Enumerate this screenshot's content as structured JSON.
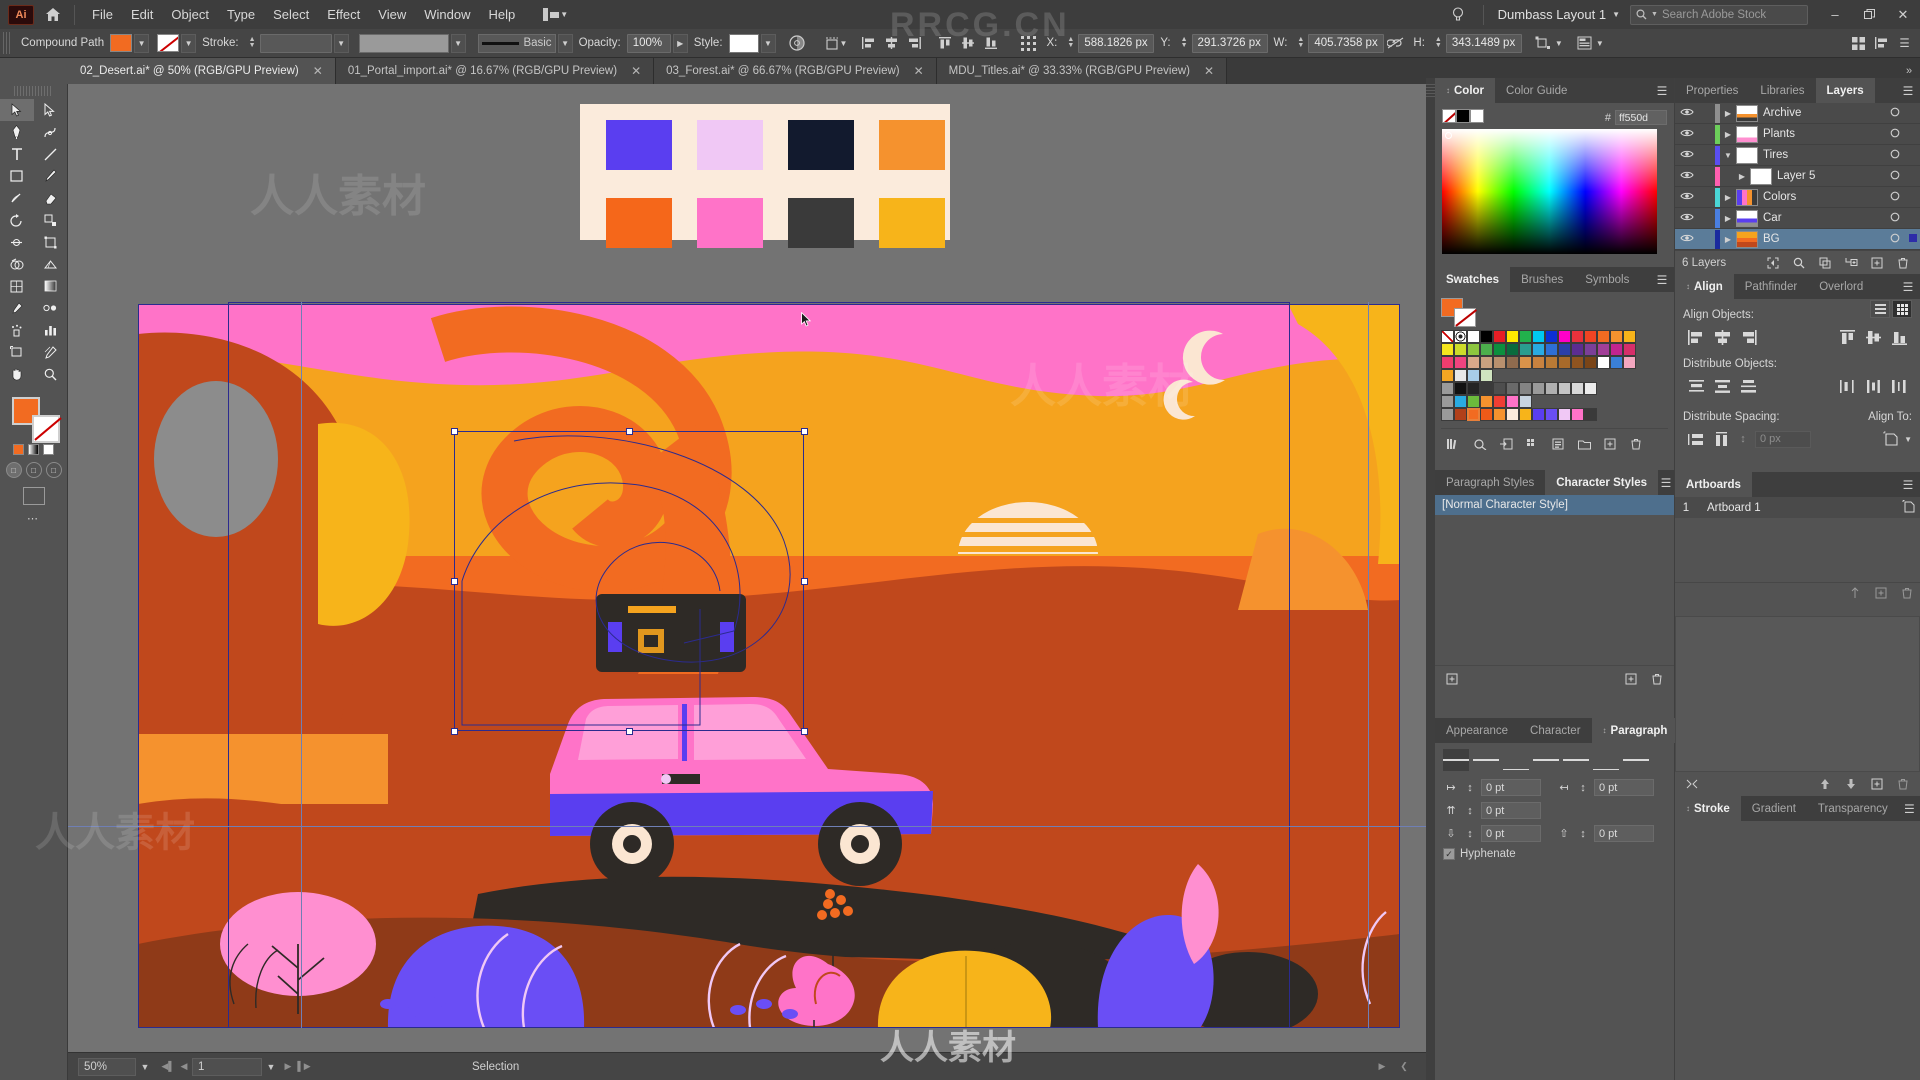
{
  "app": {
    "logo": "Ai",
    "home_icon": "home-icon"
  },
  "menubar": {
    "items": [
      "File",
      "Edit",
      "Object",
      "Type",
      "Select",
      "Effect",
      "View",
      "Window",
      "Help"
    ],
    "layout_name": "Dumbass Layout 1",
    "search_placeholder": "Search Adobe Stock",
    "bulb_icon": "lightbulb-icon",
    "minimize": "–",
    "restore": "❐",
    "close": "✕"
  },
  "controlbar": {
    "object_label": "Compound Path",
    "fill_color": "#f26b21",
    "stroke_label": "Stroke:",
    "stroke_weight": "",
    "brush_label": "Basic",
    "opacity_label": "Opacity:",
    "opacity_value": "100%",
    "style_label": "Style:",
    "x_label": "X:",
    "x_value": "588.1826 px",
    "y_label": "Y:",
    "y_value": "291.3726 px",
    "w_label": "W:",
    "w_value": "405.7358 px",
    "h_label": "H:",
    "h_value": "343.1489 px",
    "link_icon": "unlink-icon",
    "transform_icon": "transform-icon",
    "document_setup_icon": "document-setup-icon",
    "preferences_icon": "preferences-icon",
    "arrange_icon": "arrange-icon",
    "align_icon": "align-icon",
    "more_icon": "more-options-icon"
  },
  "tabs": [
    {
      "label": "02_Desert.ai* @ 50% (RGB/GPU Preview)",
      "active": true
    },
    {
      "label": "01_Portal_import.ai* @ 16.67% (RGB/GPU Preview)",
      "active": false
    },
    {
      "label": "03_Forest.ai* @ 66.67% (RGB/GPU Preview)",
      "active": false
    },
    {
      "label": "MDU_Titles.ai* @ 33.33% (RGB/GPU Preview)",
      "active": false
    }
  ],
  "toolbar": {
    "tools": [
      "selection-tool",
      "direct-selection-tool",
      "pen-tool",
      "curvature-tool",
      "type-tool",
      "line-segment-tool",
      "rectangle-tool",
      "paintbrush-tool",
      "shaper-tool",
      "eraser-tool",
      "rotate-tool",
      "scale-tool",
      "width-tool",
      "free-transform-tool",
      "shape-builder-tool",
      "perspective-grid-tool",
      "mesh-tool",
      "gradient-tool",
      "eyedropper-tool",
      "blend-tool",
      "symbol-sprayer-tool",
      "column-graph-tool",
      "artboard-tool",
      "slice-tool",
      "hand-tool",
      "zoom-tool"
    ],
    "fill_color": "#f26b21",
    "stroke_color": "#ffffff",
    "more_tools": "⋯"
  },
  "canvas": {
    "swatch_card": {
      "row1": [
        "#5a3ef0",
        "#f0c8f5",
        "#121a2e",
        "#f5922e"
      ],
      "row2": [
        "#f5671a",
        "#ff73c8",
        "#3a3a3a",
        "#f7b41a"
      ]
    },
    "artwork_name": "desert-sunset-illustration",
    "zoom": "50%"
  },
  "statusbar": {
    "zoom": "50%",
    "page": "1",
    "tool": "Selection",
    "first_icon": "first-page-icon",
    "prev_icon": "prev-page-icon",
    "next_icon": "next-page-icon",
    "last_icon": "last-page-icon"
  },
  "color_panel": {
    "tabs": [
      "Color",
      "Color Guide"
    ],
    "active": "Color",
    "hex_prefix": "#",
    "hex_value": "ff550d"
  },
  "swatches_panel": {
    "tabs": [
      "Swatches",
      "Brushes",
      "Symbols"
    ],
    "active": "Swatches",
    "current_fill": "#f26b21",
    "rows": [
      [
        "none",
        "registration",
        "#ffffff",
        "#000000",
        "#e61e25",
        "#ffe800",
        "#22b14c",
        "#00c8f0",
        "#0b2fd6",
        "#ff00c8",
        "#e8323c",
        "#f04423",
        "#f26b21",
        "#f5922e",
        "#f7b41a"
      ],
      [
        "#f5e61e",
        "#cddb2a",
        "#8dc63f",
        "#4cae4c",
        "#0c8f3e",
        "#0a6b3d",
        "#2a9d8f",
        "#29abe2",
        "#2e6fd6",
        "#2b3fa8",
        "#5c2d91",
        "#7b3f98",
        "#a23f98",
        "#c2248f",
        "#d62e6a"
      ],
      [
        "#ee3d6e",
        "#f0447f",
        "#d9a88a",
        "#c9a07f",
        "#b8906e",
        "#8f6b4e",
        "#d9934a",
        "#c8823f",
        "#b97a35",
        "#a86a2a",
        "#8f5420",
        "#7a4518",
        "#ffffff",
        "#3a7fd6",
        "#f4a7c0"
      ],
      [
        "#f5a623",
        "#e8e8e8",
        "#a8cde8",
        "#d0e4c0"
      ],
      [
        "folder",
        "#121212",
        "#242424",
        "#3a3a3a",
        "#4e4e4e",
        "#6a6a6a",
        "#848484",
        "#9a9a9a",
        "#b0b0b0",
        "#c4c4c4",
        "#d8d8d8",
        "#ececec"
      ],
      [
        "folder",
        "#29abe2",
        "#6cbb3c",
        "#f5922e",
        "#ef3e33",
        "#ff73c8",
        "#c8d4e0"
      ],
      [
        "folder",
        "#b1401a",
        "#f26b21",
        "#ef5a18",
        "#f5922e",
        "#fbebdc",
        "#f7b41a",
        "#5a3ef0",
        "#6a4ef5",
        "#f0c8f5",
        "#ff73c8",
        "#3a3a3a"
      ]
    ],
    "footer_icons": [
      "libraries-icon",
      "color-group-icon",
      "import-icon",
      "show-swatches-icon",
      "swatch-options-icon",
      "new-group-icon",
      "new-swatch-icon",
      "delete-swatch-icon"
    ]
  },
  "character_styles_panel": {
    "tabs": [
      "Paragraph Styles",
      "Character Styles"
    ],
    "active": "Character Styles",
    "items": [
      "[Normal Character Style]"
    ],
    "footer_icons": [
      "new-style-icon",
      "delete-style-icon"
    ]
  },
  "paragraph_panel": {
    "tabs": [
      "Appearance",
      "Character",
      "Paragraph"
    ],
    "active": "Paragraph",
    "align_buttons": [
      "align-left",
      "align-center",
      "align-right",
      "justify-last-left",
      "justify-last-center",
      "justify-last-right",
      "justify-all"
    ],
    "left_indent": "0 pt",
    "right_indent": "0 pt",
    "first_line_indent": "0 pt",
    "space_before": "0 pt",
    "space_after": "0 pt",
    "hyphenate_label": "Hyphenate",
    "hyphenate_checked": true
  },
  "layers_panel": {
    "tabs": [
      "Properties",
      "Libraries",
      "Layers"
    ],
    "active": "Layers",
    "layers": [
      {
        "name": "Archive",
        "color": "#8f8f8f",
        "indent": 0,
        "expanded": false,
        "selected": false,
        "visible": true
      },
      {
        "name": "Plants",
        "color": "#6ccf5a",
        "indent": 0,
        "expanded": false,
        "selected": false,
        "visible": true
      },
      {
        "name": "Tires",
        "color": "#5a4ef0",
        "indent": 0,
        "expanded": true,
        "selected": false,
        "visible": true
      },
      {
        "name": "Layer 5",
        "color": "#ff5fb0",
        "indent": 1,
        "expanded": false,
        "selected": false,
        "visible": true
      },
      {
        "name": "Colors",
        "color": "#4ad6d6",
        "indent": 0,
        "expanded": false,
        "selected": false,
        "visible": true
      },
      {
        "name": "Car",
        "color": "#4a7fe0",
        "indent": 0,
        "expanded": false,
        "selected": false,
        "visible": true
      },
      {
        "name": "BG",
        "color": "#1a2a9e",
        "indent": 0,
        "expanded": false,
        "selected": true,
        "visible": true
      }
    ],
    "count_label": "6 Layers",
    "footer_icons": [
      "locate-object-icon",
      "search-icon",
      "make-clipping-mask-icon",
      "new-sublayer-icon",
      "new-layer-icon",
      "delete-layer-icon"
    ]
  },
  "align_panel": {
    "tabs": [
      "Align",
      "Pathfinder",
      "Overlord"
    ],
    "active": "Align",
    "align_objects_label": "Align Objects:",
    "distribute_objects_label": "Distribute Objects:",
    "distribute_spacing_label": "Distribute Spacing:",
    "align_to_label": "Align To:",
    "spacing_value": "0 px",
    "align_icons": [
      "align-left-edges",
      "align-horizontal-center",
      "align-right-edges",
      "align-top-edges",
      "align-vertical-center",
      "align-bottom-edges"
    ],
    "distribute_icons": [
      "distribute-top",
      "distribute-vertical-center",
      "distribute-bottom",
      "distribute-left",
      "distribute-horizontal-center",
      "distribute-right"
    ],
    "spacing_icons": [
      "distribute-vertical-space",
      "distribute-horizontal-space"
    ],
    "align_to_icon": "align-to-selection-icon"
  },
  "artboards_panel": {
    "tabs": [
      "Artboards"
    ],
    "active": "Artboards",
    "items": [
      {
        "num": "1",
        "name": "Artboard 1"
      }
    ],
    "footer_icons": [
      "move-artboard-icon",
      "new-artboard-icon",
      "delete-artboard-icon"
    ]
  },
  "stroke_panel": {
    "tabs": [
      "Stroke",
      "Gradient",
      "Transparency"
    ],
    "active": "Stroke"
  },
  "graphic_styles_panel": {
    "footer_icons": [
      "break-link-icon",
      "move-up-icon",
      "move-down-icon",
      "new-style-icon",
      "delete-icon"
    ]
  },
  "watermarks": [
    "RRCG.CN",
    "人人素材"
  ]
}
